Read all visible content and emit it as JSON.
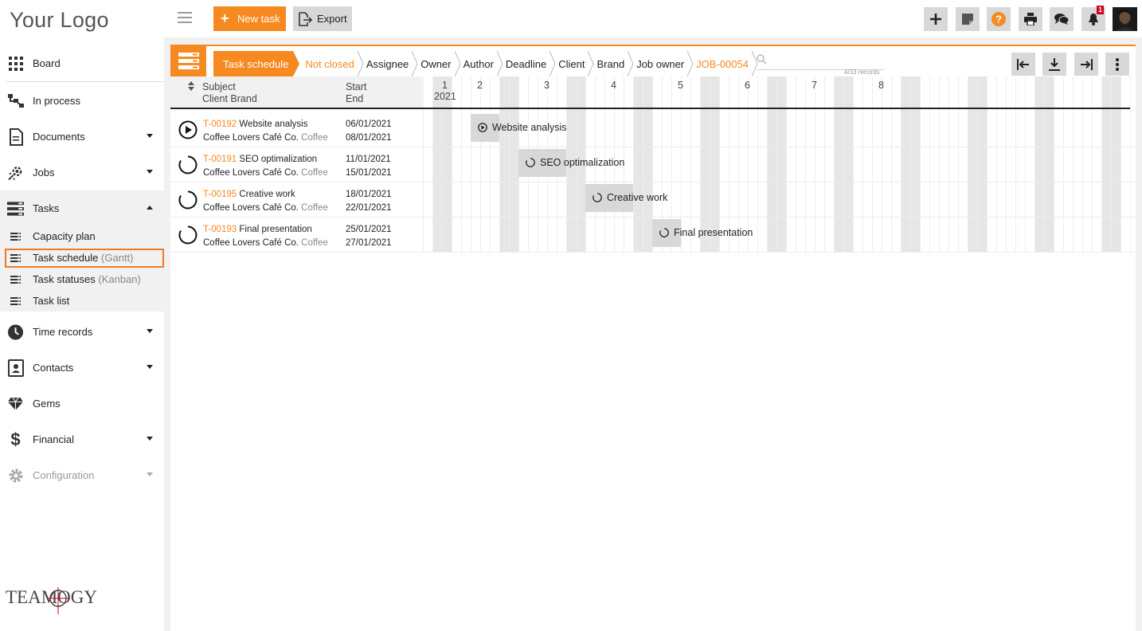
{
  "app": {
    "logo_text": "Your Logo",
    "brand": "TEAMOGY"
  },
  "sidebar": {
    "items": [
      {
        "label": "Board",
        "icon": "board-grid-icon"
      },
      {
        "label": "In process",
        "icon": "process-flow-icon"
      },
      {
        "label": "Documents",
        "icon": "document-icon",
        "expandable": true
      },
      {
        "label": "Jobs",
        "icon": "jobs-gear-icon",
        "expandable": true
      },
      {
        "label": "Tasks",
        "icon": "tasks-icon",
        "expandable": true,
        "expanded": true
      },
      {
        "label": "Time records",
        "icon": "clock-icon",
        "expandable": true
      },
      {
        "label": "Contacts",
        "icon": "contact-card-icon",
        "expandable": true
      },
      {
        "label": "Gems",
        "icon": "diamond-icon"
      },
      {
        "label": "Financial",
        "icon": "dollar-icon",
        "expandable": true
      },
      {
        "label": "Configuration",
        "icon": "settings-gear-icon",
        "expandable": true,
        "disabled": true
      }
    ],
    "subitems": [
      {
        "label": "Capacity plan",
        "suffix": ""
      },
      {
        "label": "Task schedule",
        "suffix": "(Gantt)",
        "active": true
      },
      {
        "label": "Task statuses",
        "suffix": "(Kanban)"
      },
      {
        "label": "Task list",
        "suffix": ""
      }
    ]
  },
  "toolbar": {
    "new_task_label": "New task",
    "export_label": "Export",
    "notification_count": "1"
  },
  "breadcrumbs": [
    {
      "label": "Task schedule",
      "style": "active"
    },
    {
      "label": "Not closed",
      "style": "orange"
    },
    {
      "label": "Assignee",
      "style": "normal"
    },
    {
      "label": "Owner",
      "style": "normal"
    },
    {
      "label": "Author",
      "style": "normal"
    },
    {
      "label": "Deadline",
      "style": "normal"
    },
    {
      "label": "Client",
      "style": "normal"
    },
    {
      "label": "Brand",
      "style": "normal"
    },
    {
      "label": "Job owner",
      "style": "normal"
    },
    {
      "label": "JOB-00054",
      "style": "orange"
    }
  ],
  "search": {
    "placeholder": "",
    "records": "4/33 records"
  },
  "grid": {
    "col_subject": "Subject",
    "col_client_brand": "Client Brand",
    "col_start": "Start",
    "col_end": "End",
    "year": "2021",
    "weeks": [
      "1",
      "2",
      "3",
      "4",
      "5",
      "6",
      "7",
      "8"
    ]
  },
  "tasks": [
    {
      "id": "T-00192",
      "name": "Website analysis",
      "client": "Coffee Lovers Café Co.",
      "brand": "Coffee",
      "start": "06/01/2021",
      "end": "08/01/2021",
      "status": "running"
    },
    {
      "id": "T-00191",
      "name": "SEO optimalization",
      "client": "Coffee Lovers Café Co.",
      "brand": "Coffee",
      "start": "11/01/2021",
      "end": "15/01/2021",
      "status": "open"
    },
    {
      "id": "T-00195",
      "name": "Creative work",
      "client": "Coffee Lovers Café Co.",
      "brand": "Coffee",
      "start": "18/01/2021",
      "end": "22/01/2021",
      "status": "open"
    },
    {
      "id": "T-00193",
      "name": "Final presentation",
      "client": "Coffee Lovers Café Co.",
      "brand": "Coffee",
      "start": "25/01/2021",
      "end": "27/01/2021",
      "status": "open"
    }
  ],
  "colors": {
    "accent": "#f6891f",
    "button_gray": "#d8d8d8",
    "bar_gray": "#d8d8d8",
    "weekend_gray": "#e6e6e6",
    "badge_red": "#d0021b"
  }
}
